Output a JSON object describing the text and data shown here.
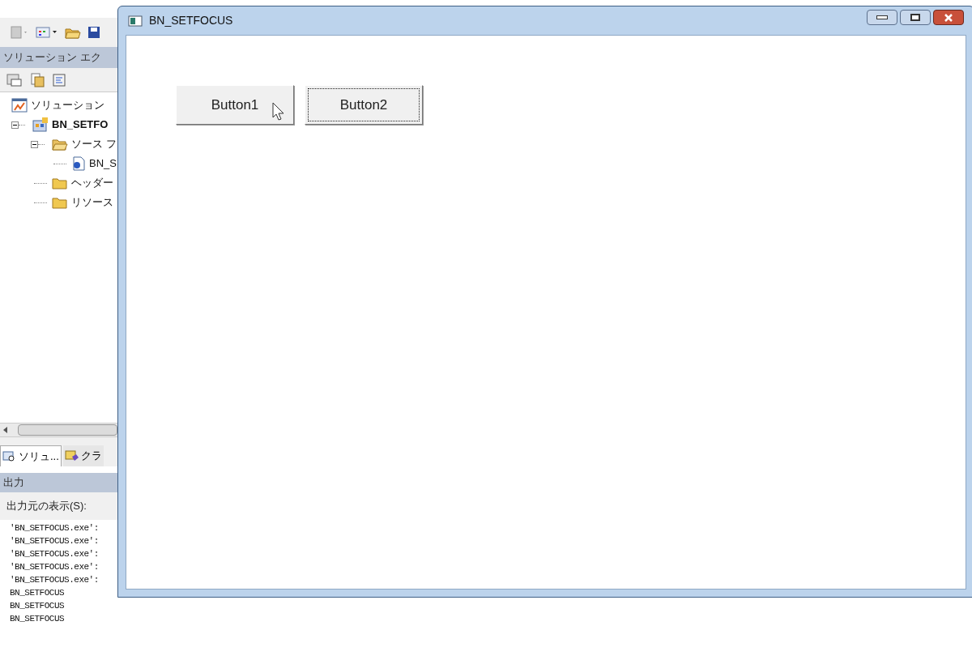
{
  "solution_explorer": {
    "title": "ソリューション エク",
    "tree": [
      {
        "label": "ソリューション",
        "bold": false,
        "kind": "solution",
        "children": [
          {
            "label": "BN_SETFO",
            "bold": true,
            "kind": "project",
            "expanded": true,
            "children": [
              {
                "label": "ソース フ",
                "bold": false,
                "kind": "folder",
                "expanded": true,
                "children": [
                  {
                    "label": "BN_S",
                    "bold": false,
                    "kind": "file"
                  }
                ]
              },
              {
                "label": "ヘッダー",
                "bold": false,
                "kind": "folder"
              },
              {
                "label": "リソース",
                "bold": false,
                "kind": "folder"
              }
            ]
          }
        ]
      }
    ],
    "tabs": [
      {
        "label": "ソリュ...",
        "selected": true
      },
      {
        "label": "クラ",
        "selected": false
      }
    ]
  },
  "output": {
    "title": "出力",
    "source_label": "出力元の表示(S):",
    "lines": [
      "'BN_SETFOCUS.exe':",
      "'BN_SETFOCUS.exe':",
      "'BN_SETFOCUS.exe':",
      "'BN_SETFOCUS.exe':",
      "'BN_SETFOCUS.exe':",
      "BN_SETFOCUS",
      "BN_SETFOCUS",
      "BN_SETFOCUS"
    ]
  },
  "window": {
    "title": "BN_SETFOCUS",
    "buttons": [
      {
        "label": "Button1",
        "focused": false,
        "hovered": true
      },
      {
        "label": "Button2",
        "focused": true,
        "hovered": false
      }
    ]
  }
}
